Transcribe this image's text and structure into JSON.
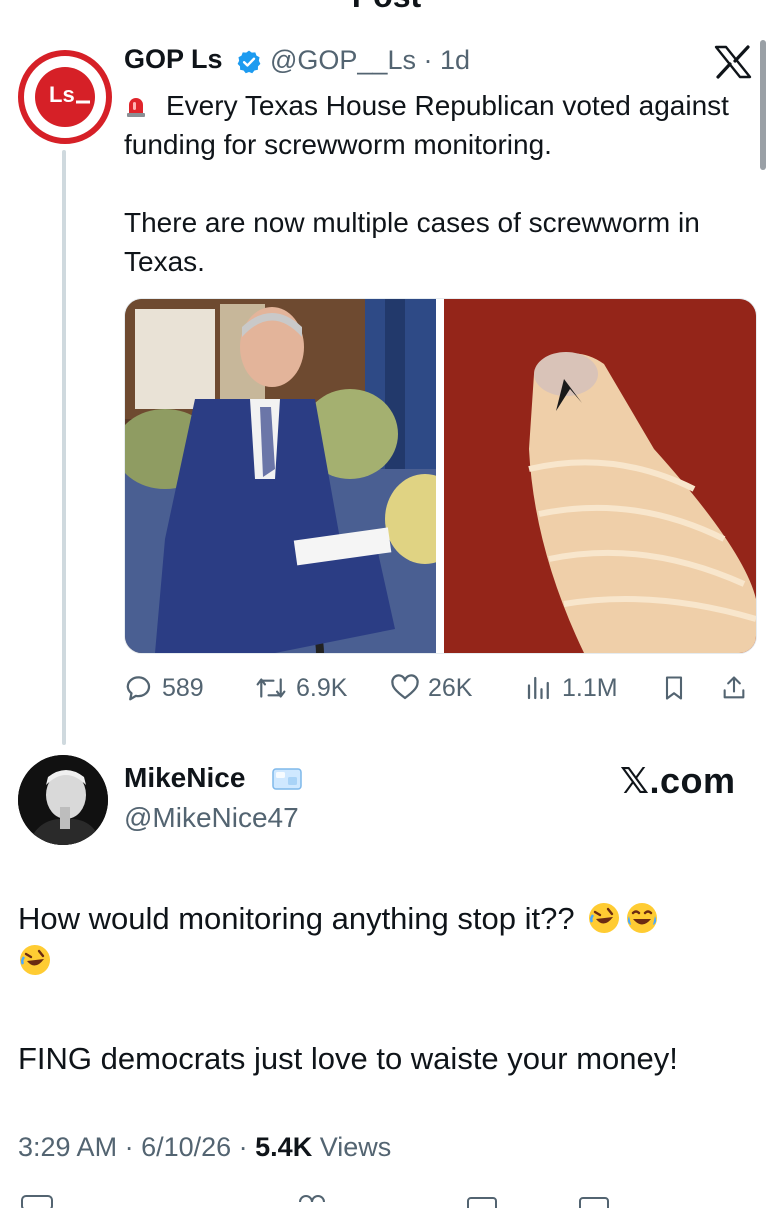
{
  "header": {
    "title": "Post"
  },
  "parent_tweet": {
    "name": "GOP Ls",
    "handle": "@GOP__Ls",
    "time": "1d",
    "avatar_text": "Ls",
    "line1": "Every Texas House Republican voted against funding for screwworm monitoring.",
    "line2": "There are now multiple cases of screwworm in Texas.",
    "stats": {
      "replies": "589",
      "reposts": "6.9K",
      "likes": "26K",
      "views": "1.1M"
    }
  },
  "reply_tweet": {
    "name": "MikeNice",
    "handle": "@MikeNice47",
    "brand": "𝕏.com",
    "text1": "How would monitoring anything stop it??",
    "text2": "FING democrats just love to waiste your money!",
    "time": "3:29 AM",
    "date": "6/10/26",
    "views_count": "5.4K",
    "views_label": "Views"
  },
  "colors": {
    "brand_red": "#d62027",
    "verified_blue": "#1d9bf0",
    "muted": "#536471"
  }
}
